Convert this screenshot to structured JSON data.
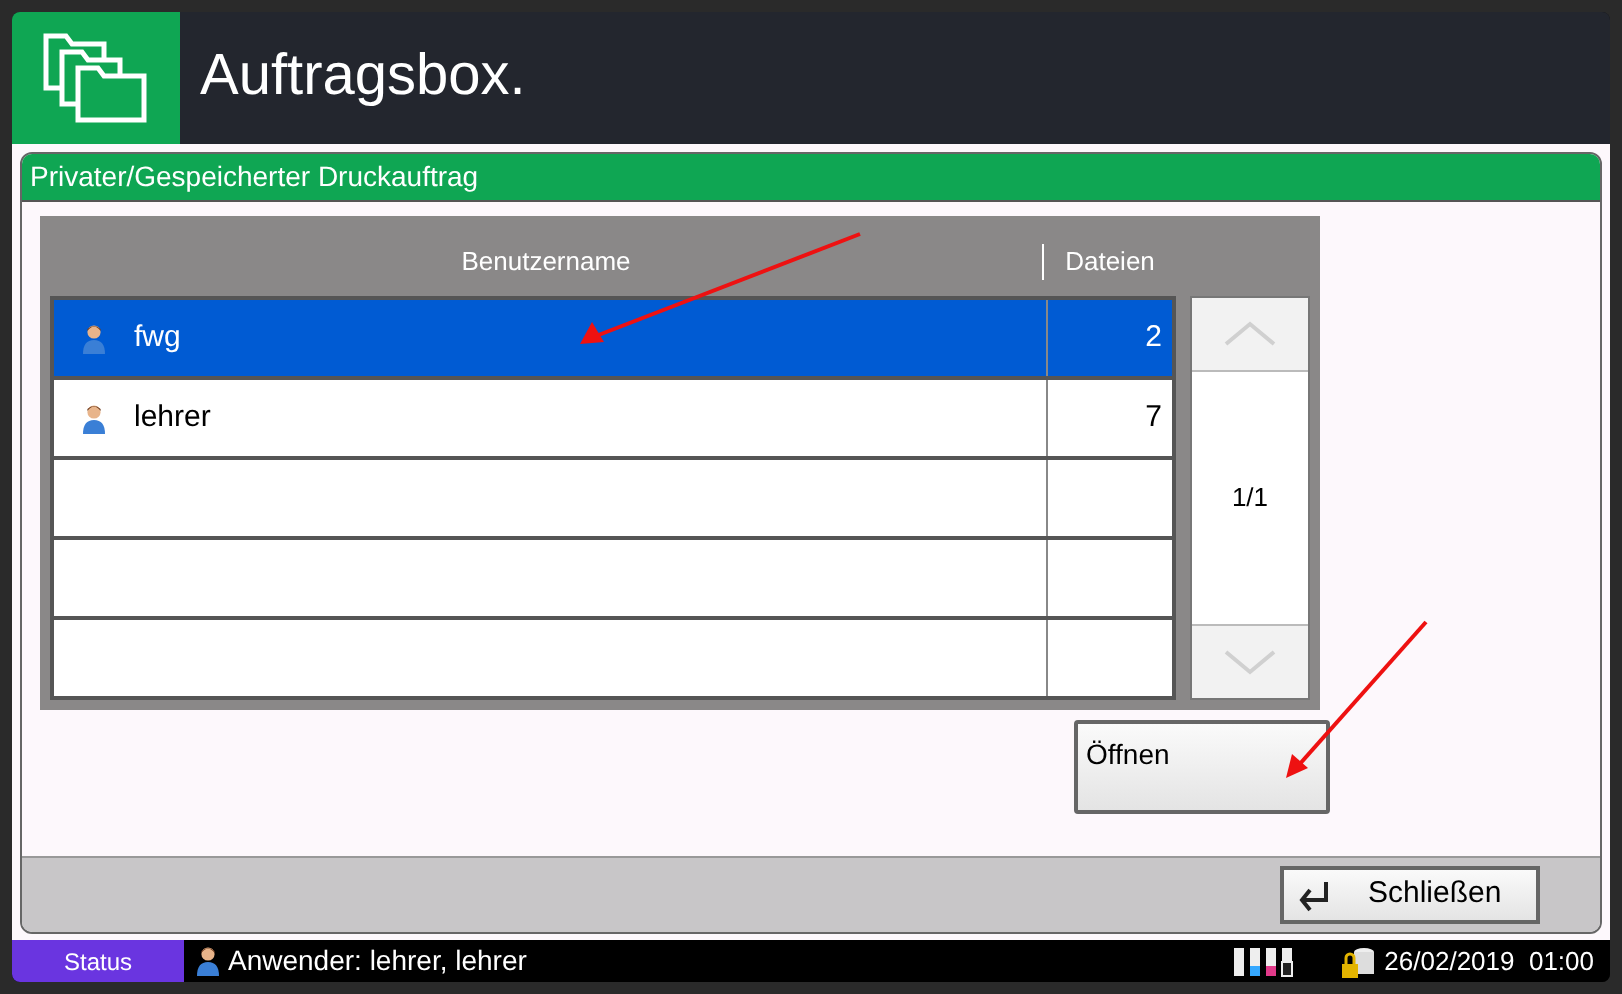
{
  "header": {
    "title": "Auftragsbox."
  },
  "panel": {
    "title": "Privater/Gespeicherter Druckauftrag"
  },
  "table": {
    "columns": [
      "Benutzername",
      "Dateien"
    ],
    "rows": [
      {
        "name": "fwg",
        "files": "2",
        "selected": true
      },
      {
        "name": "lehrer",
        "files": "7",
        "selected": false
      }
    ]
  },
  "pager": {
    "page": "1/1"
  },
  "buttons": {
    "open": "Öffnen",
    "close": "Schließen"
  },
  "status_bar": {
    "status": "Status",
    "user": "Anwender: lehrer, lehrer",
    "datetime": "26/02/2019  01:00"
  }
}
